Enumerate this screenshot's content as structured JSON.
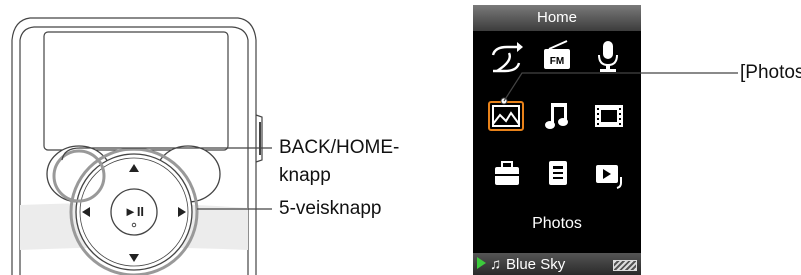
{
  "device_callouts": {
    "back_home_line1": "BACK/HOME-",
    "back_home_line2": "knapp",
    "five_way": "5-veisknapp"
  },
  "screen": {
    "title": "Home",
    "selected_label": "Photos",
    "now_playing": "Blue Sky",
    "icons": [
      "shuffle-icon",
      "fm-radio-icon",
      "microphone-icon",
      "photos-icon",
      "music-note-icon",
      "video-film-icon",
      "settings-toolbox-icon",
      "podcast-document-icon",
      "playlist-icon"
    ],
    "selected_highlight_color": "#e8821a"
  },
  "screen_callout": "[Photos]",
  "dpad_symbols": {
    "play_pause": "►II"
  }
}
